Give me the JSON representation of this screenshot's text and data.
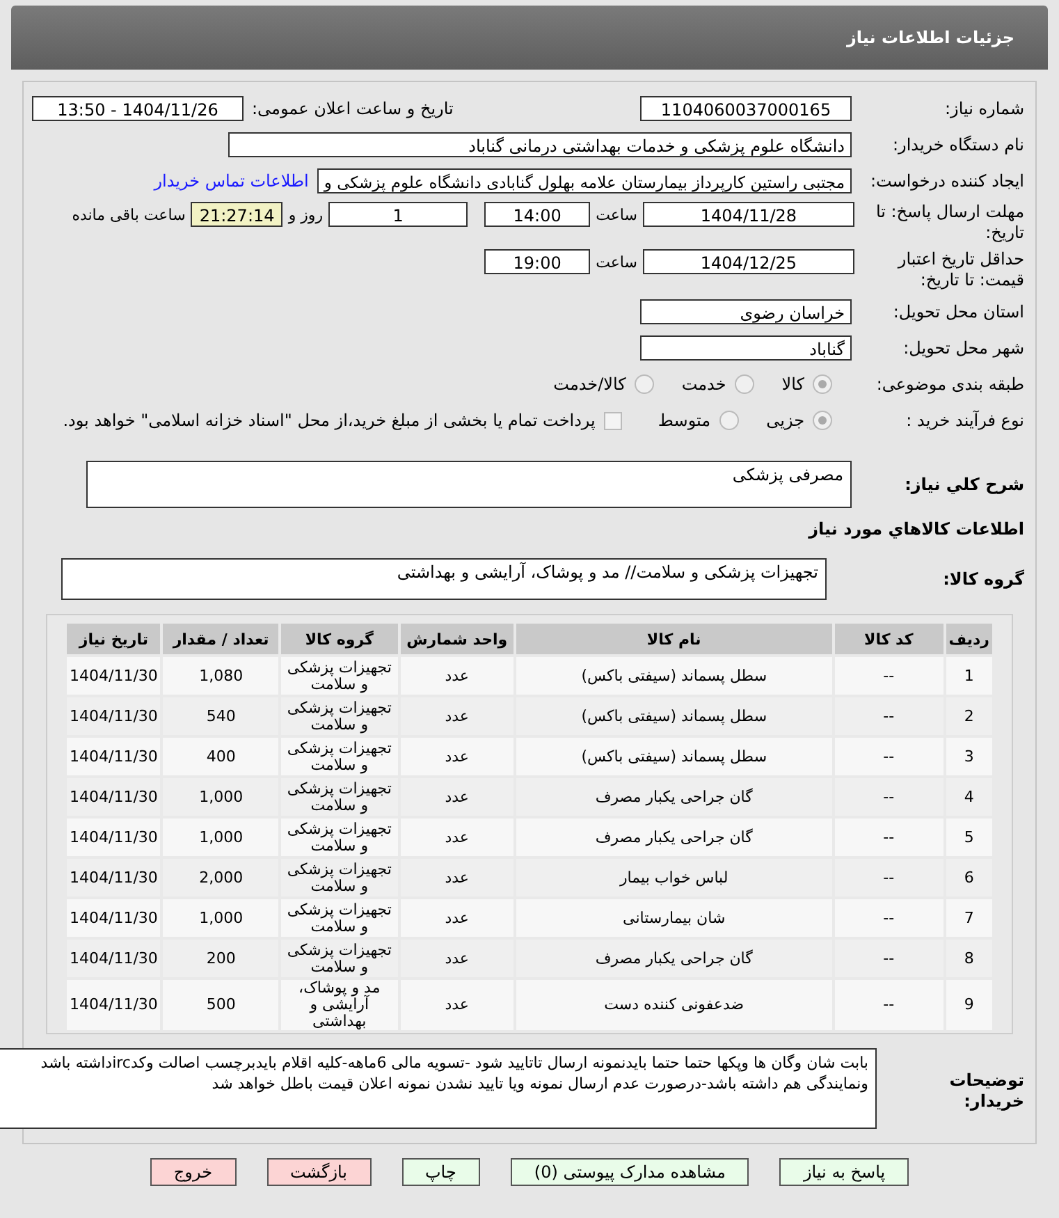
{
  "header": {
    "title": "جزئیات اطلاعات نیاز"
  },
  "need_number": {
    "label": "شماره نیاز:",
    "value": "1104060037000165"
  },
  "announce": {
    "label": "تاریخ و ساعت اعلان عمومی:",
    "value": "1404/11/26 - 13:50"
  },
  "buyer": {
    "label": "نام دستگاه خریدار:",
    "value": "دانشگاه علوم پزشکی و خدمات بهداشتی درمانی گناباد"
  },
  "requester": {
    "label": "ایجاد کننده درخواست:",
    "value": "مجتبی راستین کارپرداز بیمارستان علامه بهلول گنابادی دانشگاه علوم پزشکی و",
    "link": "اطلاعات تماس خریدار"
  },
  "deadline": {
    "label": "مهلت ارسال پاسخ: تا تاریخ:",
    "date": "1404/11/28",
    "time_label": "ساعت",
    "time": "14:00",
    "days": "1",
    "days_label": "روز و",
    "remaining": "21:27:14",
    "remaining_label": "ساعت باقی مانده"
  },
  "validity": {
    "label": "حداقل تاریخ اعتبار قیمت: تا تاریخ:",
    "date": "1404/12/25",
    "time_label": "ساعت",
    "time": "19:00"
  },
  "province": {
    "label": "استان محل تحویل:",
    "value": "خراسان رضوی"
  },
  "city": {
    "label": "شهر محل تحویل:",
    "value": "گناباد"
  },
  "category": {
    "label": "طبقه بندی موضوعی:",
    "options": [
      {
        "label": "کالا",
        "selected": true
      },
      {
        "label": "خدمت",
        "selected": false
      },
      {
        "label": "کالا/خدمت",
        "selected": false
      }
    ]
  },
  "purchase_type": {
    "label": "نوع فرآیند خرید :",
    "options": [
      {
        "label": "جزیی",
        "selected": true
      },
      {
        "label": "متوسط",
        "selected": false
      }
    ],
    "payment_checkbox": {
      "label": "پرداخت تمام یا بخشی از مبلغ خرید،از محل \"اسناد خزانه اسلامی\" خواهد بود.",
      "checked": false
    }
  },
  "description": {
    "label": "شرح کلي نياز:",
    "value": "مصرفی پزشکی"
  },
  "goods_title": "اطلاعات کالاهاي مورد نياز",
  "goods_group": {
    "label": "گروه کالا:",
    "value": "تجهیزات پزشکی و سلامت// مد و پوشاک، آرایشی و بهداشتی"
  },
  "table": {
    "columns": [
      "ردیف",
      "کد کالا",
      "نام کالا",
      "واحد شمارش",
      "گروه کالا",
      "تعداد / مقدار",
      "تاریخ نیاز"
    ],
    "rows": [
      [
        "1",
        "--",
        "سطل پسماند (سیفتی باکس)",
        "عدد",
        "تجهیزات پزشکی و سلامت",
        "1,080",
        "1404/11/30"
      ],
      [
        "2",
        "--",
        "سطل پسماند (سیفتی باکس)",
        "عدد",
        "تجهیزات پزشکی و سلامت",
        "540",
        "1404/11/30"
      ],
      [
        "3",
        "--",
        "سطل پسماند (سیفتی باکس)",
        "عدد",
        "تجهیزات پزشکی و سلامت",
        "400",
        "1404/11/30"
      ],
      [
        "4",
        "--",
        "گان جراحی یکبار مصرف",
        "عدد",
        "تجهیزات پزشکی و سلامت",
        "1,000",
        "1404/11/30"
      ],
      [
        "5",
        "--",
        "گان جراحی یکبار مصرف",
        "عدد",
        "تجهیزات پزشکی و سلامت",
        "1,000",
        "1404/11/30"
      ],
      [
        "6",
        "--",
        "لباس خواب بیمار",
        "عدد",
        "تجهیزات پزشکی و سلامت",
        "2,000",
        "1404/11/30"
      ],
      [
        "7",
        "--",
        "شان بیمارستانی",
        "عدد",
        "تجهیزات پزشکی و سلامت",
        "1,000",
        "1404/11/30"
      ],
      [
        "8",
        "--",
        "گان جراحی یکبار مصرف",
        "عدد",
        "تجهیزات پزشکی و سلامت",
        "200",
        "1404/11/30"
      ],
      [
        "9",
        "--",
        "ضدعفونی کننده دست",
        "عدد",
        "مد و پوشاک، آرایشی و بهداشتی",
        "500",
        "1404/11/30"
      ]
    ]
  },
  "notes": {
    "label": "توضیحات خریدار:",
    "value": "بابت شان وگان ها وپکها حتما  حتما بایدنمونه ارسال تاتایید شود -تسویه مالی 6ماهه-کلیه اقلام بایدبرچسب اصالت وکدircداشته باشد ونمایندگی هم داشته باشد-درصورت عدم ارسال نمونه ویا تایید نشدن نمونه اعلان قیمت باطل خواهد شد"
  },
  "buttons": [
    {
      "label": "پاسخ به نیاز",
      "kind": "action"
    },
    {
      "label": "مشاهده مدارک پیوستی (0)",
      "kind": "action"
    },
    {
      "label": "چاپ",
      "kind": "action"
    },
    {
      "label": "بازگشت",
      "kind": "exit"
    },
    {
      "label": "خروج",
      "kind": "exit"
    }
  ]
}
